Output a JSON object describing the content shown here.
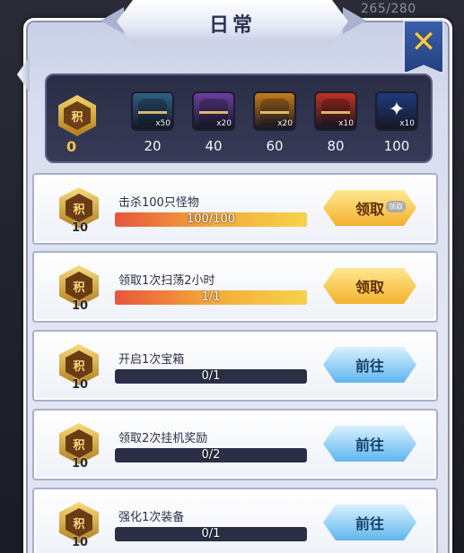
{
  "window": {
    "title": "日常",
    "topright_counter": "265/280"
  },
  "score": {
    "value": "0",
    "badge_label": "积"
  },
  "rewards": [
    {
      "threshold": "20",
      "mult": "x50",
      "color": "#2f5f83"
    },
    {
      "threshold": "40",
      "mult": "x20",
      "color": "#6b3f9e"
    },
    {
      "threshold": "60",
      "mult": "x20",
      "color": "#c97a1c"
    },
    {
      "threshold": "80",
      "mult": "x10",
      "color": "#c2301f"
    },
    {
      "threshold": "100",
      "mult": "x10",
      "color": "#1f3a7a"
    }
  ],
  "tasks": [
    {
      "name": "击杀100只怪物",
      "progress_text": "100/100",
      "progress": 1.0,
      "points": "10",
      "badge": "积",
      "action": "领取",
      "action_type": "claim",
      "tag": "领取"
    },
    {
      "name": "领取1次扫荡2小时",
      "progress_text": "1/1",
      "progress": 1.0,
      "points": "10",
      "badge": "积",
      "action": "领取",
      "action_type": "claim",
      "tag": ""
    },
    {
      "name": "开启1次宝箱",
      "progress_text": "0/1",
      "progress": 0.0,
      "points": "10",
      "badge": "积",
      "action": "前往",
      "action_type": "goto",
      "tag": ""
    },
    {
      "name": "领取2次挂机奖励",
      "progress_text": "0/2",
      "progress": 0.0,
      "points": "10",
      "badge": "积",
      "action": "前往",
      "action_type": "goto",
      "tag": ""
    },
    {
      "name": "强化1次装备",
      "progress_text": "0/1",
      "progress": 0.0,
      "points": "10",
      "badge": "积",
      "action": "前往",
      "action_type": "goto",
      "tag": ""
    }
  ],
  "icons": {
    "close": "close-x-icon",
    "badge": "hexagon-score-icon",
    "chest": "treasure-chest-icon",
    "card": "star-card-icon"
  }
}
